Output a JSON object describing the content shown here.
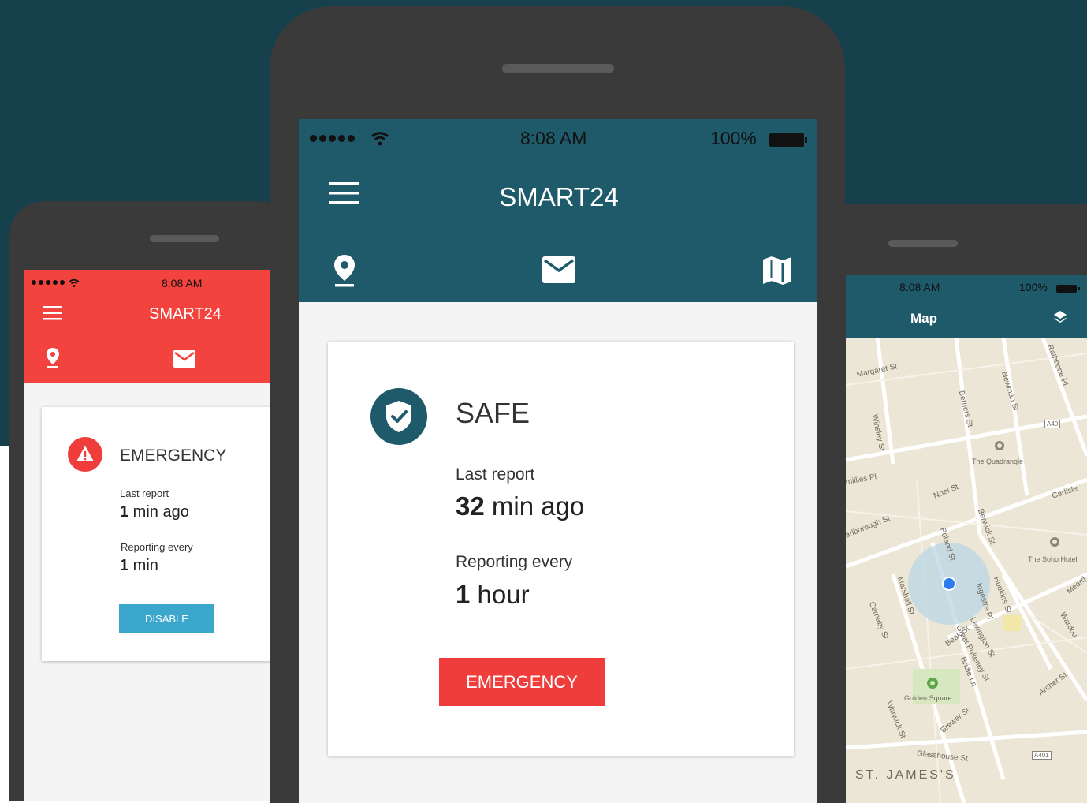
{
  "colors": {
    "background_dark": "#17404d",
    "teal_bar": "#1f5a6a",
    "red_bar": "#f2433e",
    "emergency_button": "#ee3d3a",
    "disable_button": "#3ba7cc",
    "safe_badge": "#1f5a6a"
  },
  "phones": {
    "left": {
      "status": {
        "time": "8:08 AM"
      },
      "title": "SMART24",
      "nav_icons": [
        "location-pin-icon",
        "mail-icon"
      ],
      "card": {
        "state": "EMERGENCY",
        "last_report_label": "Last report",
        "last_report_number": "1",
        "last_report_unit": " min ago",
        "reporting_label": "Reporting every",
        "reporting_number": "1",
        "reporting_unit": " min",
        "button": "DISABLE"
      }
    },
    "center": {
      "status": {
        "time": "8:08 AM",
        "battery": "100%"
      },
      "title": "SMART24",
      "nav_icons": [
        "location-pin-icon",
        "mail-icon",
        "map-icon"
      ],
      "card": {
        "state": "SAFE",
        "last_report_label": "Last report",
        "last_report_number": "32",
        "last_report_unit": " min ago",
        "reporting_label": "Reporting every",
        "reporting_number": "1",
        "reporting_unit": " hour",
        "button": "EMERGENCY"
      }
    },
    "right": {
      "status": {
        "time": "8:08 AM",
        "battery": "100%"
      },
      "title": "Map",
      "map": {
        "streets": [
          "Margaret St",
          "Berners St",
          "Newman St",
          "Rathbone Pl",
          "Winsley St",
          "A40",
          "The Quadrangle",
          "Noel St",
          "Carlisle",
          "Berwick St",
          "arlborough St",
          "Poland St",
          "The Soho Hotel",
          "Marshall St",
          "Hopkins St",
          "Ingestre Pl",
          "Carnaby St",
          "Meard",
          "Wardou",
          "Beak St",
          "Great Pulteney St",
          "Lexington St",
          "Bridle Ln",
          "Archer St",
          "Golden Square",
          "Warwick St",
          "Brewer St",
          "Glasshouse St",
          "A401",
          "ST. JAMES'S",
          "millies Pl"
        ]
      }
    }
  }
}
